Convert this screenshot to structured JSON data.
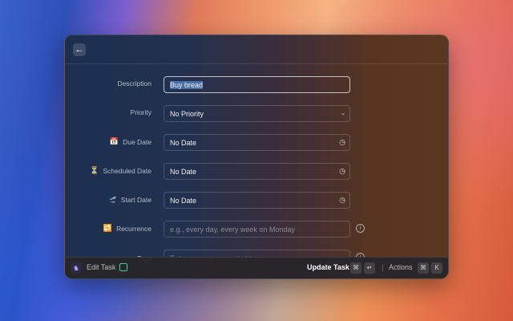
{
  "header": {
    "back_icon": "arrow-left-icon"
  },
  "form": {
    "description": {
      "label": "Description",
      "value": "Buy bread"
    },
    "priority": {
      "label": "Priority",
      "value": "No Priority"
    },
    "due_date": {
      "label": "Due Date",
      "value": "No Date",
      "icon": "📅"
    },
    "scheduled_date": {
      "label": "Scheduled Date",
      "value": "No Date",
      "icon": "⏳"
    },
    "start_date": {
      "label": "Start Date",
      "value": "No Date",
      "icon": "🛫"
    },
    "recurrence": {
      "label": "Recurrence",
      "placeholder": "e.g., every day, every week on Monday",
      "icon": "🔁"
    },
    "tags": {
      "label": "Tags",
      "placeholder": "Enter comma-separated tags"
    }
  },
  "footer": {
    "title": "Edit Task",
    "primary_action": "Update Task",
    "primary_keys": [
      "⌘",
      "↵"
    ],
    "actions_label": "Actions",
    "actions_keys": [
      "⌘",
      "K"
    ]
  }
}
